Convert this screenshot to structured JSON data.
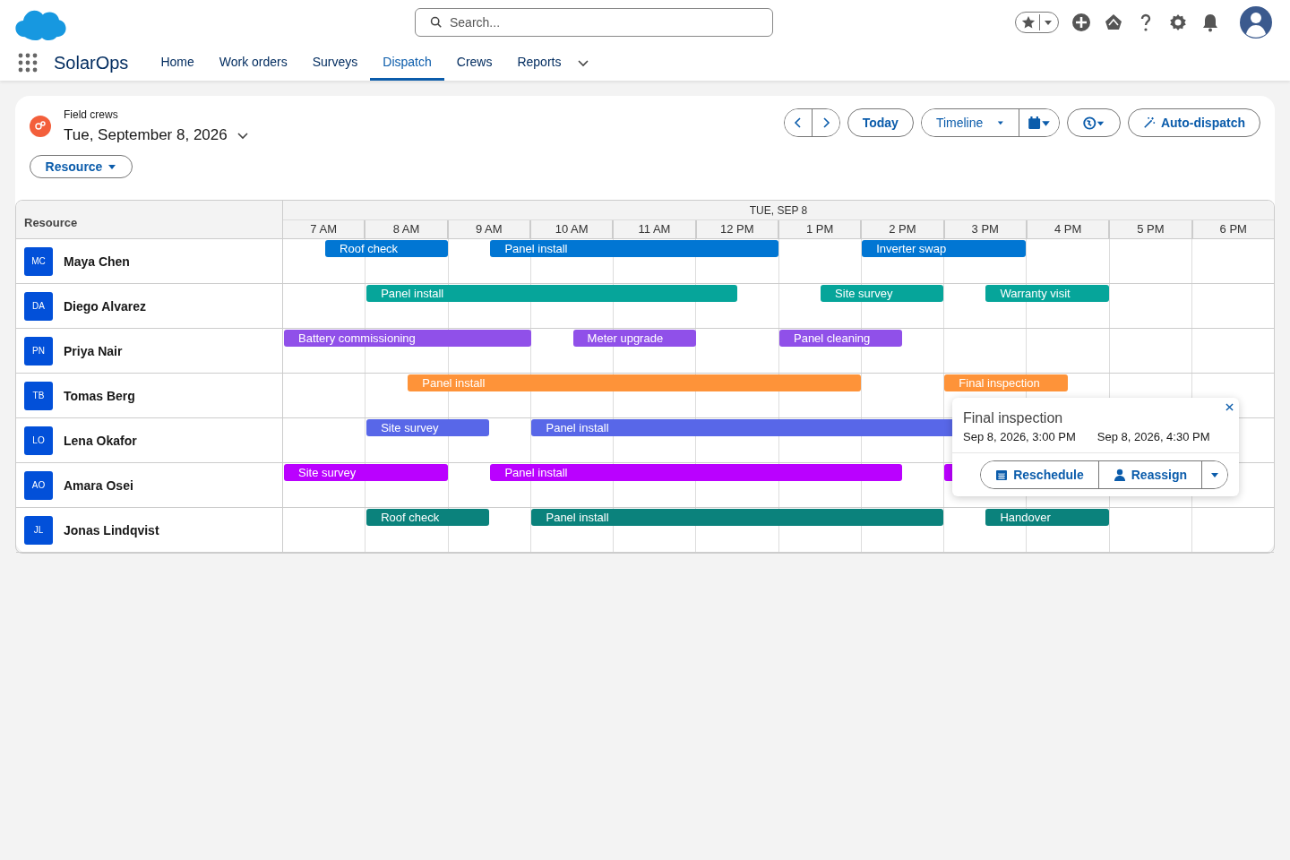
{
  "app": {
    "name": "SolarOps",
    "search": {
      "placeholder": "Search..."
    }
  },
  "nav": [
    {
      "label": "Home",
      "selected": false
    },
    {
      "label": "Work orders",
      "selected": false
    },
    {
      "label": "Surveys",
      "selected": false
    },
    {
      "label": "Dispatch",
      "selected": true
    },
    {
      "label": "Crews",
      "selected": false
    },
    {
      "label": "Reports",
      "selected": false
    }
  ],
  "header": {
    "subtitle": "Field crews",
    "date": "Tue, September 8, 2026",
    "filter": "Resource",
    "buttons": {
      "today": "Today",
      "view": "Timeline",
      "auto": "Auto-dispatch"
    }
  },
  "schedule": {
    "resource_heading": "Resource",
    "day": "TUE, SEP 8",
    "hours": [
      "7 AM",
      "8 AM",
      "9 AM",
      "10 AM",
      "11 AM",
      "12 PM",
      "1 PM",
      "2 PM",
      "3 PM",
      "4 PM",
      "5 PM",
      "6 PM"
    ],
    "rows": [
      {
        "initials": "MC",
        "name": "Maya Chen",
        "color": "#0176d3",
        "half_hours": [
          {
            "kind": "free"
          },
          {
            "kind": "start",
            "label": "Roof check"
          },
          {
            "kind": "busy"
          },
          {
            "kind": "busy"
          },
          {
            "kind": "free"
          },
          {
            "kind": "start",
            "label": "Panel install"
          },
          {
            "kind": "busy"
          },
          {
            "kind": "busy"
          },
          {
            "kind": "busy"
          },
          {
            "kind": "busy"
          },
          {
            "kind": "busy"
          },
          {
            "kind": "busy"
          },
          {
            "kind": "free"
          },
          {
            "kind": "free"
          },
          {
            "kind": "start",
            "label": "Inverter swap"
          },
          {
            "kind": "busy"
          },
          {
            "kind": "busy"
          },
          {
            "kind": "busy"
          },
          {
            "kind": "free"
          },
          {
            "kind": "free"
          },
          {
            "kind": "free"
          },
          {
            "kind": "free"
          },
          {
            "kind": "free"
          },
          {
            "kind": "free"
          }
        ]
      },
      {
        "initials": "DA",
        "name": "Diego Alvarez",
        "color": "#06a59a",
        "half_hours": [
          {
            "kind": "free"
          },
          {
            "kind": "free"
          },
          {
            "kind": "start",
            "label": "Panel install"
          },
          {
            "kind": "busy"
          },
          {
            "kind": "busy"
          },
          {
            "kind": "busy"
          },
          {
            "kind": "busy"
          },
          {
            "kind": "busy"
          },
          {
            "kind": "busy"
          },
          {
            "kind": "busy"
          },
          {
            "kind": "busy"
          },
          {
            "kind": "free"
          },
          {
            "kind": "free"
          },
          {
            "kind": "start",
            "label": "Site survey"
          },
          {
            "kind": "busy"
          },
          {
            "kind": "busy"
          },
          {
            "kind": "free"
          },
          {
            "kind": "start",
            "label": "Warranty visit"
          },
          {
            "kind": "busy"
          },
          {
            "kind": "busy"
          },
          {
            "kind": "free"
          },
          {
            "kind": "free"
          },
          {
            "kind": "free"
          },
          {
            "kind": "free"
          }
        ]
      },
      {
        "initials": "PN",
        "name": "Priya Nair",
        "color": "#9050e9",
        "half_hours": [
          {
            "kind": "start",
            "label": "Battery commissioning"
          },
          {
            "kind": "busy"
          },
          {
            "kind": "busy"
          },
          {
            "kind": "busy"
          },
          {
            "kind": "busy"
          },
          {
            "kind": "busy"
          },
          {
            "kind": "free"
          },
          {
            "kind": "start",
            "label": "Meter upgrade"
          },
          {
            "kind": "busy"
          },
          {
            "kind": "busy"
          },
          {
            "kind": "free"
          },
          {
            "kind": "free"
          },
          {
            "kind": "start",
            "label": "Panel cleaning"
          },
          {
            "kind": "busy"
          },
          {
            "kind": "busy"
          },
          {
            "kind": "free"
          },
          {
            "kind": "free"
          },
          {
            "kind": "free"
          },
          {
            "kind": "free"
          },
          {
            "kind": "free"
          },
          {
            "kind": "free"
          },
          {
            "kind": "free"
          },
          {
            "kind": "free"
          },
          {
            "kind": "free"
          }
        ]
      },
      {
        "initials": "TB",
        "name": "Tomas Berg",
        "color": "#fe9339",
        "half_hours": [
          {
            "kind": "free"
          },
          {
            "kind": "free"
          },
          {
            "kind": "free"
          },
          {
            "kind": "start",
            "label": "Panel install"
          },
          {
            "kind": "busy"
          },
          {
            "kind": "busy"
          },
          {
            "kind": "busy"
          },
          {
            "kind": "busy"
          },
          {
            "kind": "busy"
          },
          {
            "kind": "busy"
          },
          {
            "kind": "busy"
          },
          {
            "kind": "busy"
          },
          {
            "kind": "busy"
          },
          {
            "kind": "busy"
          },
          {
            "kind": "free"
          },
          {
            "kind": "free"
          },
          {
            "kind": "start",
            "label": "Final inspection"
          },
          {
            "kind": "busy"
          },
          {
            "kind": "busy"
          },
          {
            "kind": "free"
          },
          {
            "kind": "free"
          },
          {
            "kind": "free"
          },
          {
            "kind": "free"
          },
          {
            "kind": "free"
          }
        ]
      },
      {
        "initials": "LO",
        "name": "Lena Okafor",
        "color": "#5867e8",
        "half_hours": [
          {
            "kind": "free"
          },
          {
            "kind": "free"
          },
          {
            "kind": "start",
            "label": "Site survey"
          },
          {
            "kind": "busy"
          },
          {
            "kind": "busy"
          },
          {
            "kind": "free"
          },
          {
            "kind": "start",
            "label": "Panel install"
          },
          {
            "kind": "busy"
          },
          {
            "kind": "busy"
          },
          {
            "kind": "busy"
          },
          {
            "kind": "busy"
          },
          {
            "kind": "busy"
          },
          {
            "kind": "busy"
          },
          {
            "kind": "busy"
          },
          {
            "kind": "busy"
          },
          {
            "kind": "busy"
          },
          {
            "kind": "busy"
          },
          {
            "kind": "busy"
          },
          {
            "kind": "free"
          },
          {
            "kind": "free"
          },
          {
            "kind": "free"
          },
          {
            "kind": "free"
          },
          {
            "kind": "free"
          },
          {
            "kind": "free"
          }
        ]
      },
      {
        "initials": "AO",
        "name": "Amara Osei",
        "color": "#ba01ff",
        "half_hours": [
          {
            "kind": "start",
            "label": "Site survey"
          },
          {
            "kind": "busy"
          },
          {
            "kind": "busy"
          },
          {
            "kind": "busy"
          },
          {
            "kind": "free"
          },
          {
            "kind": "start",
            "label": "Panel install"
          },
          {
            "kind": "busy"
          },
          {
            "kind": "busy"
          },
          {
            "kind": "busy"
          },
          {
            "kind": "busy"
          },
          {
            "kind": "busy"
          },
          {
            "kind": "busy"
          },
          {
            "kind": "busy"
          },
          {
            "kind": "busy"
          },
          {
            "kind": "busy"
          },
          {
            "kind": "free"
          },
          {
            "kind": "start"
          },
          {
            "kind": "busy"
          },
          {
            "kind": "busy"
          },
          {
            "kind": "free"
          },
          {
            "kind": "free"
          },
          {
            "kind": "free"
          },
          {
            "kind": "free"
          },
          {
            "kind": "free"
          }
        ]
      },
      {
        "initials": "JL",
        "name": "Jonas Lindqvist",
        "color": "#0b827c",
        "half_hours": [
          {
            "kind": "free"
          },
          {
            "kind": "free"
          },
          {
            "kind": "start",
            "label": "Roof check"
          },
          {
            "kind": "busy"
          },
          {
            "kind": "busy"
          },
          {
            "kind": "free"
          },
          {
            "kind": "start",
            "label": "Panel install"
          },
          {
            "kind": "busy"
          },
          {
            "kind": "busy"
          },
          {
            "kind": "busy"
          },
          {
            "kind": "busy"
          },
          {
            "kind": "busy"
          },
          {
            "kind": "busy"
          },
          {
            "kind": "busy"
          },
          {
            "kind": "busy"
          },
          {
            "kind": "busy"
          },
          {
            "kind": "free"
          },
          {
            "kind": "start",
            "label": "Handover"
          },
          {
            "kind": "busy"
          },
          {
            "kind": "busy"
          },
          {
            "kind": "free"
          },
          {
            "kind": "free"
          },
          {
            "kind": "free"
          },
          {
            "kind": "free"
          }
        ]
      }
    ]
  },
  "popover": {
    "title": "Final inspection",
    "start": "Sep 8, 2026, 3:00 PM",
    "end": "Sep 8, 2026, 4:30 PM",
    "actions": [
      "Reschedule",
      "Reassign"
    ]
  }
}
